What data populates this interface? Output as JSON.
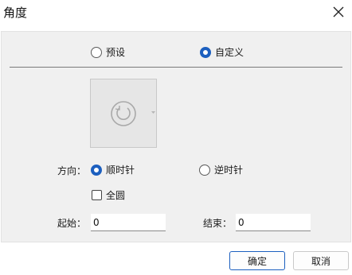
{
  "dialog": {
    "title": "角度"
  },
  "mode": {
    "options": [
      {
        "label": "预设",
        "checked": false
      },
      {
        "label": "自定义",
        "checked": true
      }
    ]
  },
  "preview": {
    "icon": "rotate-clockwise-icon"
  },
  "direction": {
    "label": "方向：",
    "options": [
      {
        "label": "顺时针",
        "checked": true
      },
      {
        "label": "逆时针",
        "checked": false
      }
    ],
    "full_circle": {
      "label": "全圆",
      "checked": false
    }
  },
  "start": {
    "label": "起始：",
    "value": "0"
  },
  "end": {
    "label": "结束：",
    "value": "0"
  },
  "buttons": {
    "ok": "确定",
    "cancel": "取消"
  },
  "colors": {
    "accent": "#1c5fbf",
    "panel_bg": "#f0f0f0"
  }
}
